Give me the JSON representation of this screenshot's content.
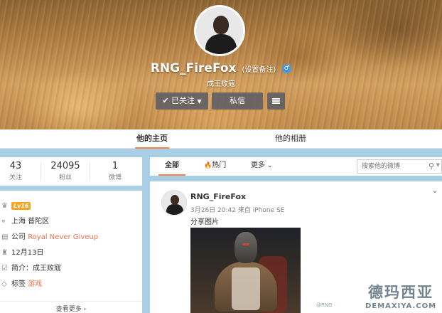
{
  "profile": {
    "name": "RNG_FireFox",
    "remark_link": "(设置备注)",
    "gender_icon": "male-icon",
    "bio": "成王败寇",
    "follow_button": "已关注",
    "message_button": "私信"
  },
  "main_tabs": {
    "home": "他的主页",
    "album": "他的相册"
  },
  "stats": [
    {
      "value": "43",
      "label": "关注"
    },
    {
      "value": "24095",
      "label": "粉丝"
    },
    {
      "value": "1",
      "label": "微博"
    }
  ],
  "info": {
    "level": "Lv16",
    "location": "上海 普陀区",
    "company_prefix": "公司",
    "company": "Royal Never Giveup",
    "birthday": "12月13日",
    "intro": "简介：成王败寇",
    "tags_prefix": "标签",
    "tag": "游戏",
    "see_more": "查看更多 ›"
  },
  "feed_tabs": {
    "all": "全部",
    "hot": "热门",
    "more": "更多"
  },
  "search": {
    "placeholder": "搜索他的微博"
  },
  "post": {
    "author": "RNG_FireFox",
    "meta": "3月26日 20:42 来自 iPhone SE",
    "text": "分享图片",
    "image_credit": "@RNG"
  },
  "watermark": {
    "cn": "德玛西亚",
    "en": "DEMAXIYA.COM"
  },
  "colors": {
    "accent_orange": "#ff8140",
    "link_orange": "#eb7350",
    "page_bg": "#a9cfe6"
  }
}
